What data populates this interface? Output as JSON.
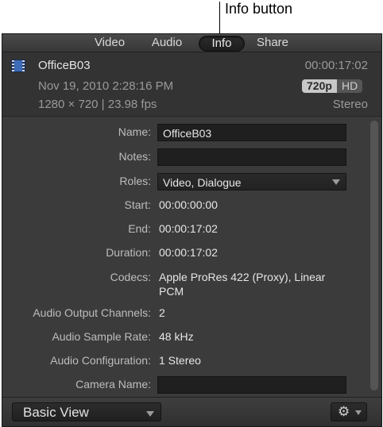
{
  "callout": {
    "text": "Info button"
  },
  "tabs": [
    {
      "label": "Video"
    },
    {
      "label": "Audio"
    },
    {
      "label": "Info"
    },
    {
      "label": "Share"
    }
  ],
  "header": {
    "clip_name": "OfficeB03",
    "duration": "00:00:17:02",
    "date": "Nov 19, 2010 2:28:16 PM",
    "format_720": "720p",
    "format_hd": "HD",
    "resolution": "1280 × 720 | 23.98 fps",
    "audio": "Stereo"
  },
  "fields": {
    "name_label": "Name:",
    "name_value": "OfficeB03",
    "notes_label": "Notes:",
    "notes_value": "",
    "roles_label": "Roles:",
    "roles_value": "Video, Dialogue",
    "start_label": "Start:",
    "start_value": "00:00:00:00",
    "end_label": "End:",
    "end_value": "00:00:17:02",
    "duration_label": "Duration:",
    "duration_value": "00:00:17:02",
    "codecs_label": "Codecs:",
    "codecs_value_line1": "Apple ProRes 422 (Proxy), Linear",
    "codecs_value_line2": "PCM",
    "aoc_label": "Audio Output Channels:",
    "aoc_value": "2",
    "asr_label": "Audio Sample Rate:",
    "asr_value": "48 kHz",
    "acfg_label": "Audio Configuration:",
    "acfg_value": "1 Stereo",
    "camera_label": "Camera Name:",
    "camera_value": ""
  },
  "footer": {
    "view_label": "Basic View",
    "gear_icon": "gear-icon"
  },
  "colors": {
    "panel_bg": "#3b3b3b",
    "accent_film": "#3c6bb8"
  }
}
